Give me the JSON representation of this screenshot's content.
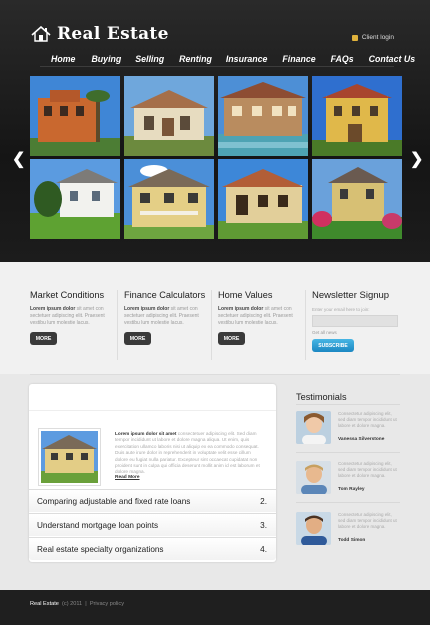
{
  "brand": {
    "name": "Real Estate"
  },
  "header": {
    "client_login": "Client login",
    "nav": [
      "Home",
      "Buying",
      "Selling",
      "Renting",
      "Insurance",
      "Finance",
      "FAQs",
      "Contact Us"
    ]
  },
  "features": [
    {
      "title": "Market Conditions",
      "bold": "Lorem ipsum dolor",
      "text": "sit amet con sectetuer adipiscing elit. Praesent vestibu lum molestie lacus.",
      "button": "MORE"
    },
    {
      "title": "Finance Calculators",
      "bold": "Lorem ipsum dolor",
      "text": "sit amet con sectetuer adipiscing elit. Praesent vestibu lum molestie lacus.",
      "button": "MORE"
    },
    {
      "title": "Home Values",
      "bold": "Lorem ipsum dolor",
      "text": "sit amet con sectetuer adipiscing elit. Praesent vestibu lum molestie lacus.",
      "button": "MORE"
    }
  ],
  "newsletter": {
    "title": "Newsletter  Signup",
    "hint": "Enter your email here to join:",
    "email_placeholder": "",
    "sub_label": "Get all news",
    "button": "SUBSCRIBE"
  },
  "article": {
    "bold": "Lorem ipsum dolor sit amet",
    "text": "consectetuer adipiscing elit. Sed diam tempor incididunt ut labore et dolore magna aliqua. Ut enim, quis exercitation ullamco laboris nisi ut aliquip ex ea commodo consequat. Duis aute irure dolor in reprehenderit in voluptate velit esse cillum dolore eu fugiat nulla pariatur. Excepteur sint occaecat cupidatat non proident sunt in culpa qui officia deserunt mollit anim id est laborum et dolore magna.",
    "read_more": "Read More"
  },
  "links": [
    {
      "label": "Comparing adjustable and fixed rate loans",
      "num": "2."
    },
    {
      "label": "Understand mortgage loan points",
      "num": "3."
    },
    {
      "label": "Real estate specialty organizations",
      "num": "4."
    }
  ],
  "testimonials": {
    "title": "Testimonials",
    "items": [
      {
        "text": "Consectetur adipiscing elit, sed diam tempor incididunt ut labore et dolore magna.",
        "name": "Vanessa Silverstone"
      },
      {
        "text": "Consectetur adipiscing elit, sed diam tempor incididunt ut labore et dolore magna.",
        "name": "Tom Rayley"
      },
      {
        "text": "Consectetur adipiscing elit, sed diam tempor incididunt ut labore et dolore magna.",
        "name": "Todd Simon"
      }
    ]
  },
  "footer": {
    "brand": "Real Estate",
    "copyright": "(c) 2011",
    "sep": "|",
    "privacy": "Privacy policy"
  }
}
